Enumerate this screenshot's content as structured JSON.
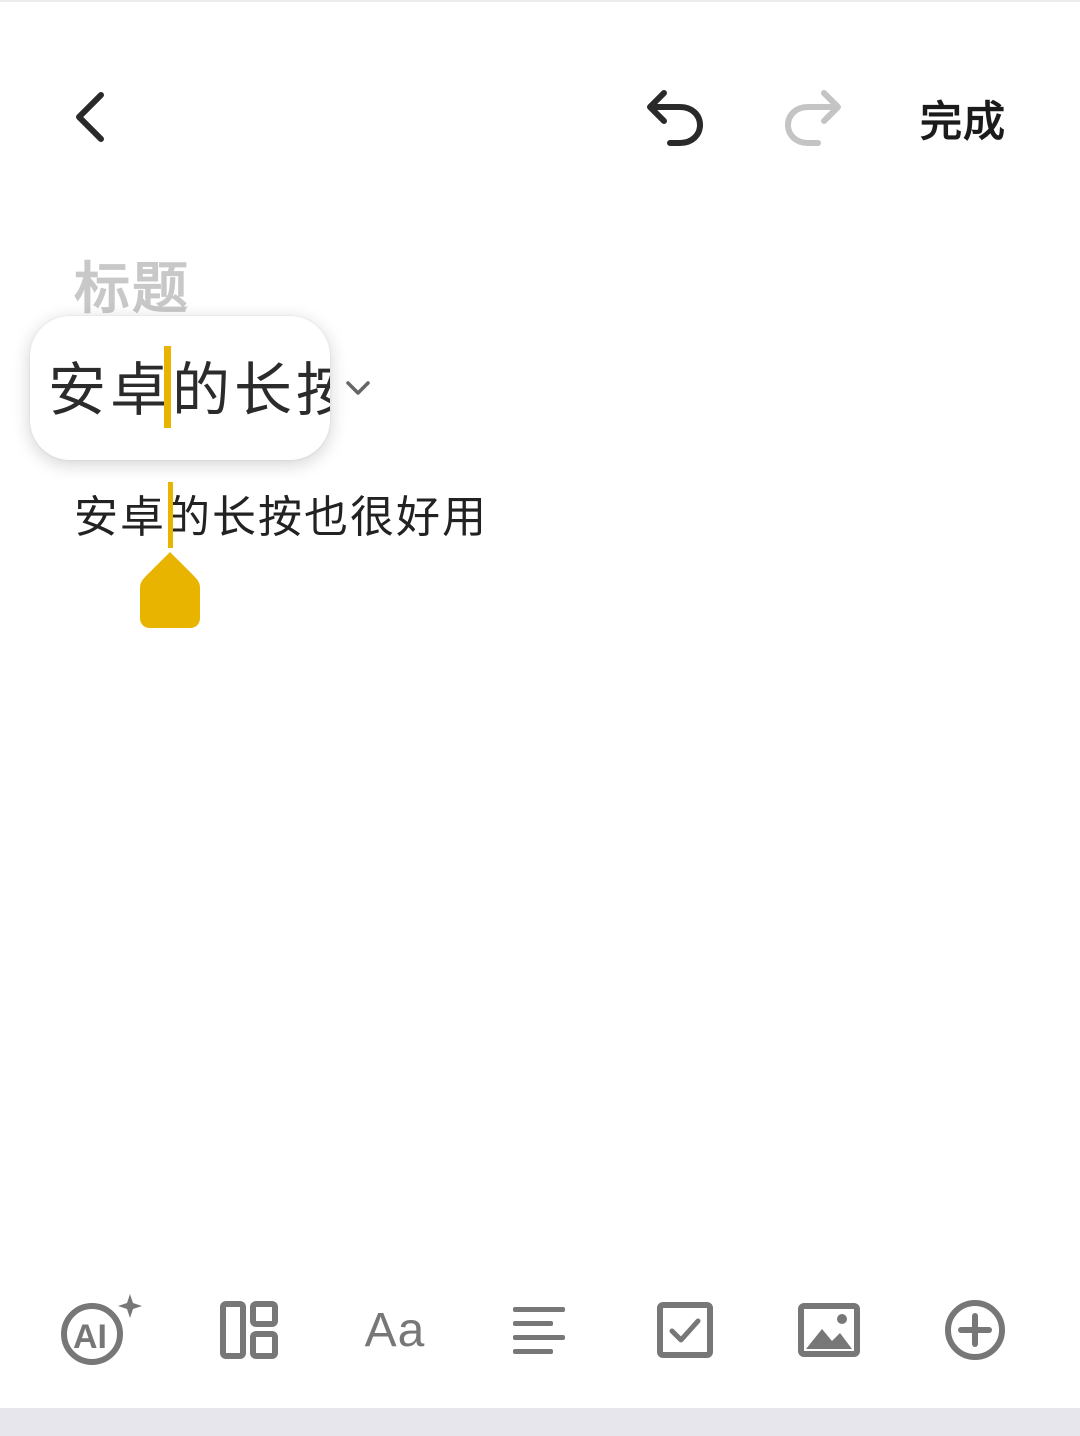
{
  "header": {
    "back_icon": "chevron-left-icon",
    "undo_icon": "undo-icon",
    "redo_icon": "redo-icon",
    "done_label": "完成"
  },
  "editor": {
    "title_placeholder": "标题",
    "body_text": "安卓的长按也很好用",
    "cursor_color": "#e9b400"
  },
  "magnifier": {
    "text": "安卓的长按"
  },
  "toolbar": {
    "items": [
      {
        "icon": "ai-sparkle-icon"
      },
      {
        "icon": "layout-grid-icon"
      },
      {
        "icon": "font-style-icon",
        "label": "Aa"
      },
      {
        "icon": "align-left-icon"
      },
      {
        "icon": "checkbox-icon"
      },
      {
        "icon": "image-icon"
      },
      {
        "icon": "add-circle-icon"
      }
    ]
  }
}
